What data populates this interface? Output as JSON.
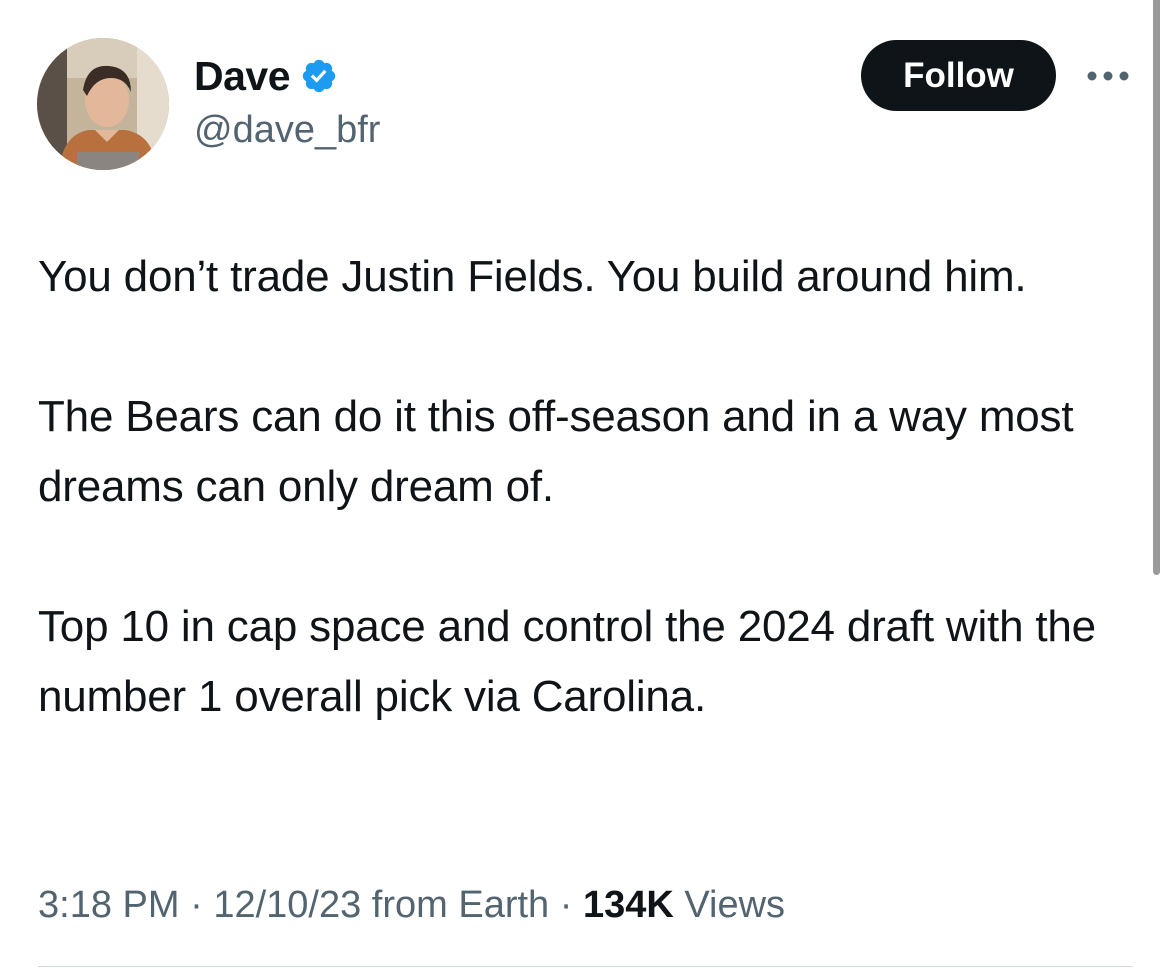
{
  "author": {
    "display_name": "Dave",
    "handle": "@dave_bfr",
    "verified": true,
    "avatar": "profile-photo"
  },
  "actions": {
    "follow_label": "Follow",
    "more_icon": "more-horizontal-icon"
  },
  "tweet": {
    "paragraphs": [
      "You don’t trade Justin Fields. You build around him.",
      "The Bears can do it this off-season and in a way most dreams can only dream of.",
      "Top 10 in cap space and control the 2024 draft with the number 1 overall pick via Carolina."
    ]
  },
  "meta": {
    "time": "3:18 PM",
    "date": "12/10/23",
    "source": "from Earth",
    "separator": "·",
    "views_count": "134K",
    "views_label": "Views"
  },
  "colors": {
    "text_primary": "#0f1419",
    "text_secondary": "#536471",
    "verified_blue": "#1d9bf0",
    "follow_bg": "#0f1419"
  }
}
